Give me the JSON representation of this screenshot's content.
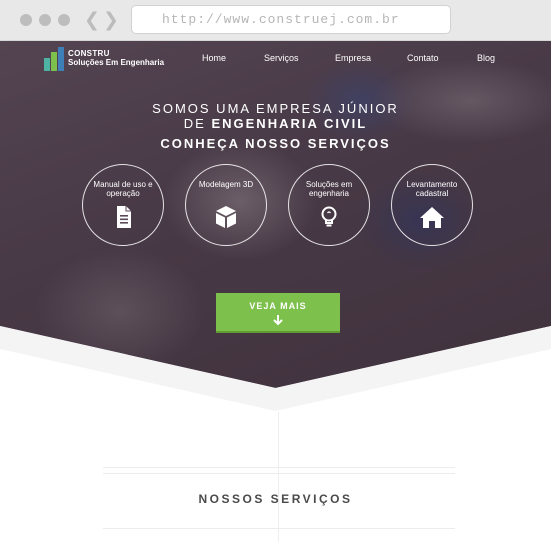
{
  "browser": {
    "url": "http://www.construej.com.br",
    "back_icon": "chevron-left-icon",
    "forward_icon": "chevron-right-icon"
  },
  "brand": {
    "name": "CONSTRU",
    "tagline": "Soluções Em Engenharia",
    "colors": {
      "green": "#7dc04c",
      "teal": "#4fb3a3",
      "blue": "#3e7fb8"
    }
  },
  "nav": {
    "items": [
      {
        "label": "Home"
      },
      {
        "label": "Serviços"
      },
      {
        "label": "Empresa"
      },
      {
        "label": "Contato"
      },
      {
        "label": "Blog"
      }
    ]
  },
  "hero": {
    "line1": "SOMOS UMA EMPRESA JÚNIOR",
    "line2_prefix": "DE",
    "line2_bold": "ENGENHARIA CIVIL",
    "line3": "CONHEÇA NOSSO SERVIÇOS"
  },
  "services": [
    {
      "label": "Manual de uso e operação",
      "icon": "document-icon"
    },
    {
      "label": "Modelagem 3D",
      "icon": "cube-icon"
    },
    {
      "label": "Soluções em engenharia",
      "icon": "lightbulb-icon"
    },
    {
      "label": "Levantamento cadastral",
      "icon": "house-icon"
    }
  ],
  "cta": {
    "label": "VEJA MAIS",
    "icon": "arrow-down-icon",
    "color": "#7dc04c"
  },
  "section": {
    "title": "NOSSOS SERVIÇOS"
  }
}
